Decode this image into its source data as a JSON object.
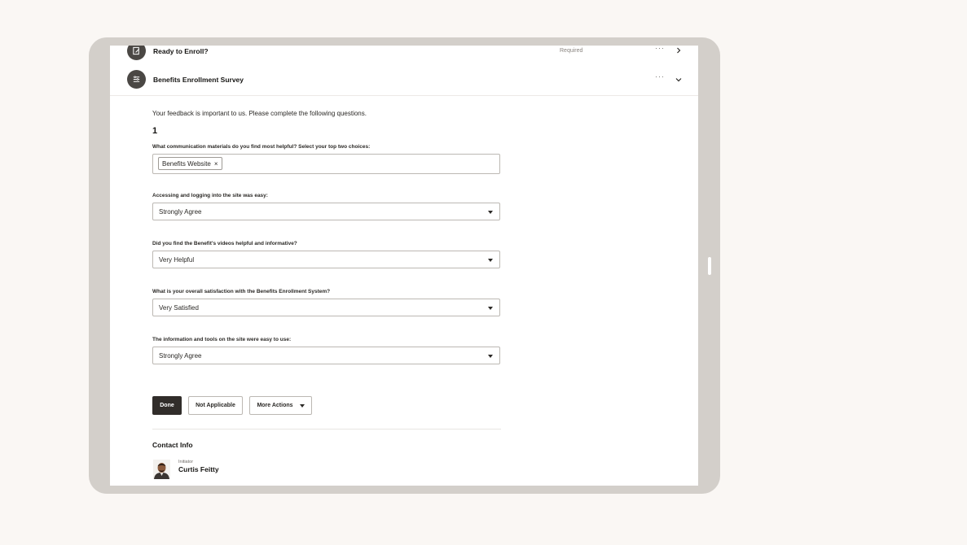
{
  "tasks": [
    {
      "title": "Ready to Enroll?",
      "status": "Required",
      "icon": "document-edit-icon"
    },
    {
      "title": "Benefits Enrollment Survey",
      "status": "",
      "icon": "survey-list-icon"
    }
  ],
  "more_glyph": "···",
  "survey": {
    "intro": "Your feedback is important to us. Please complete the following questions.",
    "page_number": "1",
    "questions": [
      {
        "label": "What communication materials do you find most helpful? Select your top two choices:",
        "chip": "Benefits Website"
      },
      {
        "label": "Accessing and logging into the site was easy:",
        "value": "Strongly Agree"
      },
      {
        "label": "Did you find the Benefit's videos helpful and informative?",
        "value": "Very Helpful"
      },
      {
        "label": "What is your overall satisfaction with the Benefits Enrollment System?",
        "value": "Very Satisfied"
      },
      {
        "label": "The information and tools on the site were easy to use:",
        "value": "Strongly Agree"
      }
    ]
  },
  "actions": {
    "done": "Done",
    "not_applicable": "Not Applicable",
    "more_actions": "More Actions"
  },
  "contact": {
    "title": "Contact Info",
    "role": "Initiator",
    "name": "Curtis Feitty"
  },
  "colors": {
    "background": "#faf7f4",
    "device_frame": "#d3cfca",
    "primary_button": "#312d2a",
    "task_icon": "#4a4744"
  }
}
